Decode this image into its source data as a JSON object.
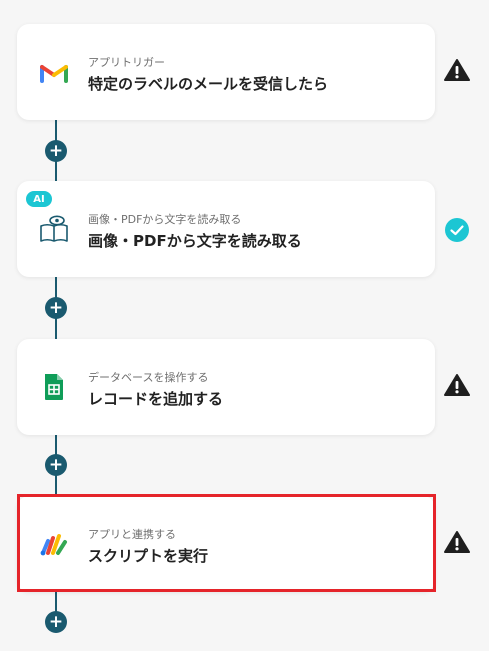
{
  "flow": {
    "steps": [
      {
        "subtitle": "アプリトリガー",
        "title": "特定のラベルのメールを受信したら",
        "icon": "gmail-icon",
        "status": "warning"
      },
      {
        "badge": "AI",
        "subtitle": "画像・PDFから文字を読み取る",
        "title": "画像・PDFから文字を読み取る",
        "icon": "ocr-book-eye-icon",
        "status": "ok"
      },
      {
        "subtitle": "データベースを操作する",
        "title": "レコードを追加する",
        "icon": "google-sheets-icon",
        "status": "warning"
      },
      {
        "subtitle": "アプリと連携する",
        "title": "スクリプトを実行",
        "icon": "google-apps-script-icon",
        "status": "warning",
        "highlighted": true
      }
    ],
    "add_button_label": "+"
  },
  "colors": {
    "connector": "#1a5a6f",
    "ai_badge": "#1cc6d3",
    "status_ok": "#1cc6d3",
    "status_warning": "#1f1f1f",
    "highlight_border": "#e5242a",
    "background": "#f6f6f6"
  }
}
